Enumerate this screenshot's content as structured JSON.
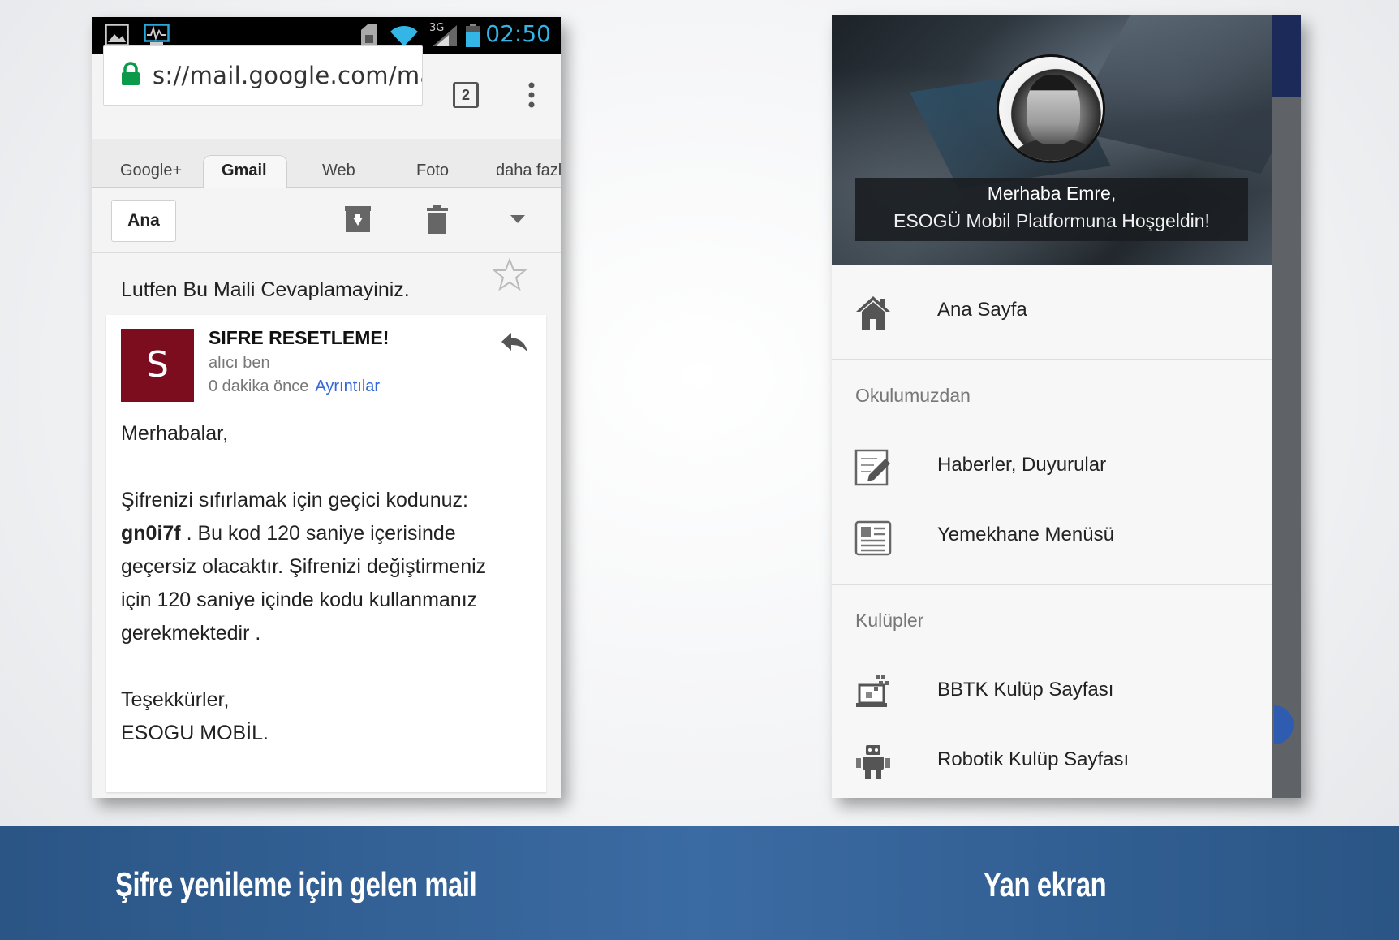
{
  "mail_screen": {
    "status_bar": {
      "time": "02:50",
      "network": "3G"
    },
    "browser": {
      "url": "s://mail.google.com/ma",
      "tab_count": "2"
    },
    "google_tabs": [
      "Google+",
      "Gmail",
      "Web",
      "Foto",
      "daha fazl"
    ],
    "toolbar": {
      "back_label": "Ana"
    },
    "subject": "Lutfen Bu Maili Cevaplamayiniz.",
    "message": {
      "avatar_letter": "S",
      "sender": "SIFRE RESETLEME!",
      "recipient": "alıcı ben",
      "time_ago": "0 dakika önce",
      "details_link": "Ayrıntılar",
      "greeting": "Merhabalar,",
      "body_line1": "Şifrenizi sıfırlamak için geçici kodunuz:",
      "code": "gn0i7f",
      "body_after_code": " . Bu kod 120 saniye içerisinde",
      "body_line3": "geçersiz olacaktır. Şifrenizi değiştirmeniz",
      "body_line4": "için 120 saniye içinde kodu kullanmanız",
      "body_line5": "gerekmektedir .",
      "signoff": "Teşekkürler,",
      "signature": "ESOGU MOBİL."
    },
    "accent_color": "#7c0d1e"
  },
  "side_screen": {
    "welcome_line1": "Merhaba Emre,",
    "welcome_line2": "ESOGÜ Mobil Platformuna Hoşgeldin!",
    "home_item": {
      "label": "Ana Sayfa",
      "icon": "home-icon"
    },
    "section_school": {
      "title": "Okulumuzdan",
      "items": [
        {
          "label": "Haberler, Duyurular",
          "icon": "news-edit-icon"
        },
        {
          "label": "Yemekhane Menüsü",
          "icon": "newspaper-icon"
        }
      ]
    },
    "section_clubs": {
      "title": "Kulüpler",
      "items": [
        {
          "label": "BBTK Kulüp Sayfası",
          "icon": "computer-club-icon"
        },
        {
          "label": "Robotik Kulüp Sayfası",
          "icon": "robot-icon"
        }
      ]
    }
  },
  "captions": {
    "left": "Şifre yenileme için gelen mail",
    "right": "Yan ekran"
  }
}
